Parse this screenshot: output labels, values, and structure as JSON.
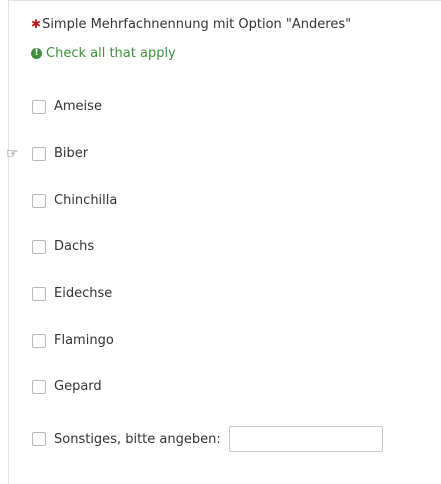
{
  "question": {
    "required_mark": "✱",
    "text": "Simple Mehrfachnennung mit Option \"Anderes\"",
    "hint_icon": "!",
    "hint": "Check all that apply"
  },
  "options": [
    {
      "label": "Ameise",
      "checked": false
    },
    {
      "label": "Biber",
      "checked": false
    },
    {
      "label": "Chinchilla",
      "checked": false
    },
    {
      "label": "Dachs",
      "checked": false
    },
    {
      "label": "Eidechse",
      "checked": false
    },
    {
      "label": "Flamingo",
      "checked": false
    },
    {
      "label": "Gepard",
      "checked": false
    }
  ],
  "other": {
    "label": "Sonstiges, bitte angeben:",
    "checked": false,
    "value": ""
  },
  "colors": {
    "required": "#b31d1d",
    "hint": "#3f8f3f",
    "text": "#333333"
  }
}
